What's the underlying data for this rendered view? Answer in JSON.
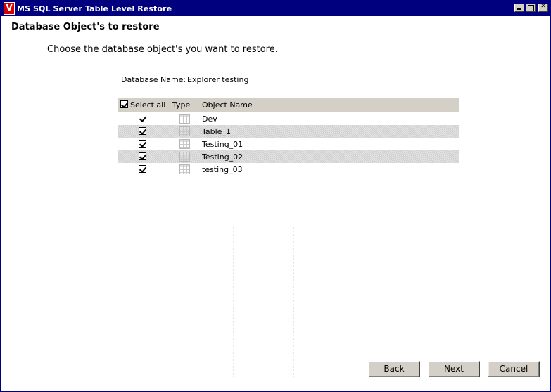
{
  "window": {
    "title": "MS SQL Server Table Level Restore",
    "app_icon_letter": "V"
  },
  "header": {
    "title": "Database Object's to restore",
    "subtitle": "Choose the database object's you want to restore."
  },
  "database": {
    "label": "Database Name:",
    "value": "Explorer testing"
  },
  "grid": {
    "columns": {
      "select_all": "Select all",
      "type": "Type",
      "object_name": "Object Name"
    },
    "rows": [
      {
        "name": "Dev",
        "checked": true
      },
      {
        "name": "Table_1",
        "checked": true
      },
      {
        "name": "Testing_01",
        "checked": true
      },
      {
        "name": "Testing_02",
        "checked": true
      },
      {
        "name": "testing_03",
        "checked": true
      }
    ]
  },
  "buttons": {
    "back": "Back",
    "next": "Next",
    "cancel": "Cancel"
  }
}
